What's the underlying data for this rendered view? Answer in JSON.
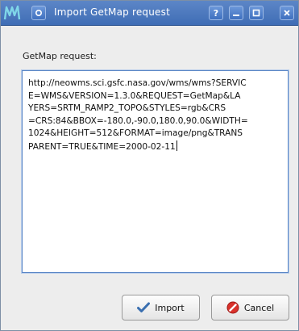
{
  "titlebar": {
    "title": "Import GetMap request",
    "buttons": [
      "help",
      "minimize",
      "maximize",
      "close"
    ]
  },
  "form": {
    "label": "GetMap request:",
    "request_lines": [
      "http://neowms.sci.gsfc.nasa.gov/wms/wms?SERVIC",
      "E=WMS&VERSION=1.3.0&REQUEST=GetMap&LA",
      "YERS=SRTM_RAMP2_TOPO&STYLES=rgb&CRS",
      "=CRS:84&BBOX=-180.0,-90.0,180.0,90.0&WIDTH=",
      "1024&HEIGHT=512&FORMAT=image/png&TRANS",
      "PARENT=TRUE&TIME=2000-02-11"
    ]
  },
  "actions": {
    "import_label": "Import",
    "cancel_label": "Cancel"
  },
  "colors": {
    "titlebar": "#3f6db5",
    "accent_border": "#5b87c6",
    "logo": "#7fd6e8",
    "cancel_icon": "#d9312b",
    "check_icon": "#3a6fb0"
  }
}
